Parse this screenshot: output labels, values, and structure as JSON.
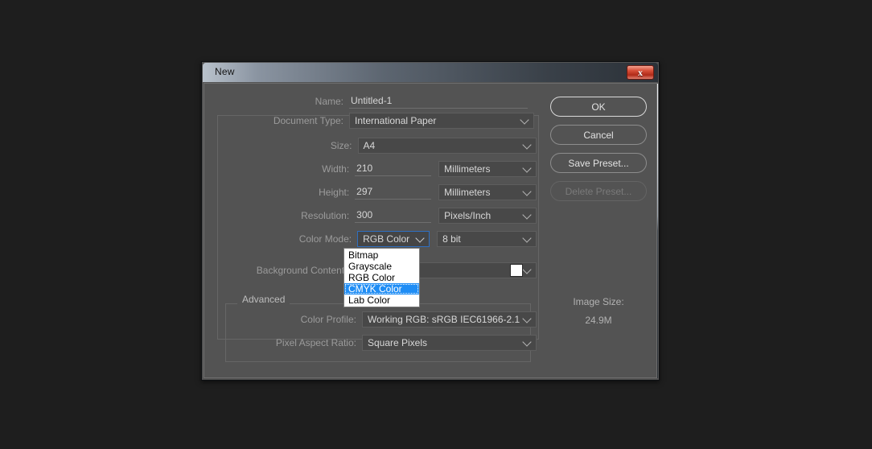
{
  "window": {
    "title": "New",
    "close_icon": "close-x-icon"
  },
  "form": {
    "name": {
      "label": "Name:",
      "value": "Untitled-1",
      "placeholder": "Untitled-1"
    },
    "document_type": {
      "label": "Document Type:",
      "value": "International Paper"
    },
    "size": {
      "label": "Size:",
      "value": "A4"
    },
    "width": {
      "label": "Width:",
      "value": "210",
      "unit": "Millimeters"
    },
    "height": {
      "label": "Height:",
      "value": "297",
      "unit": "Millimeters"
    },
    "resolution": {
      "label": "Resolution:",
      "value": "300",
      "unit": "Pixels/Inch"
    },
    "color_mode": {
      "label": "Color Mode:",
      "value": "RGB Color",
      "depth": "8 bit",
      "focused": true
    },
    "background_contents": {
      "label": "Background Contents:",
      "value": "",
      "swatch_color": "#ffffff"
    }
  },
  "color_mode_dropdown": {
    "open": true,
    "highlight_color": "#1f8df5",
    "selected_index": 3,
    "items": [
      "Bitmap",
      "Grayscale",
      "RGB Color",
      "CMYK Color",
      "Lab Color"
    ]
  },
  "advanced": {
    "group_label": "Advanced",
    "color_profile": {
      "label": "Color Profile:",
      "value": "Working RGB:  sRGB IEC61966-2.1"
    },
    "pixel_aspect_ratio": {
      "label": "Pixel Aspect Ratio:",
      "value": "Square Pixels"
    }
  },
  "buttons": {
    "ok": "OK",
    "cancel": "Cancel",
    "save_preset": "Save Preset...",
    "delete_preset": "Delete Preset..."
  },
  "image_size": {
    "title": "Image Size:",
    "value": "24.9M"
  }
}
